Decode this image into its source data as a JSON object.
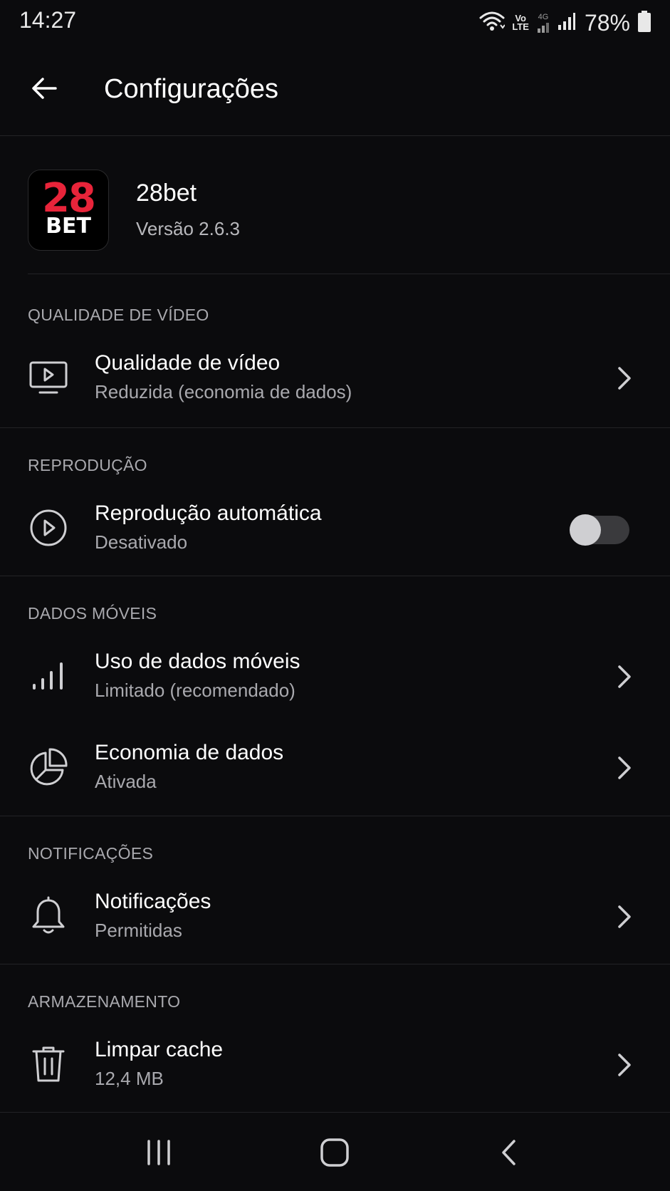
{
  "status_bar": {
    "time": "14:27",
    "volte_top": "Vo",
    "volte_bottom": "LTE",
    "network_type": "4G",
    "battery_percent": "78%"
  },
  "app_bar": {
    "title": "Configurações",
    "back_icon": "arrow-left-icon"
  },
  "app_info": {
    "logo_top": "28",
    "logo_bottom": "BET",
    "name": "28bet",
    "version": "Versão 2.6.3"
  },
  "sections": {
    "video": {
      "header": "QUALIDADE DE VÍDEO",
      "item": {
        "title": "Qualidade de vídeo",
        "subtitle": "Reduzida (economia de dados)",
        "icon": "monitor-play-icon"
      }
    },
    "playback": {
      "header": "REPRODUÇÃO",
      "item": {
        "title": "Reprodução automática",
        "subtitle": "Desativado",
        "icon": "play-circle-icon",
        "toggle_on": false
      }
    },
    "mobile_data": {
      "header": "DADOS MÓVEIS",
      "items": [
        {
          "title": "Uso de dados móveis",
          "subtitle": "Limitado (recomendado)",
          "icon": "signal-bars-icon"
        },
        {
          "title": "Economia de dados",
          "subtitle": "Ativada",
          "icon": "pie-chart-icon"
        }
      ]
    },
    "notifications": {
      "header": "NOTIFICAÇÕES",
      "item": {
        "title": "Notificações",
        "subtitle": "Permitidas",
        "icon": "bell-icon"
      }
    },
    "storage": {
      "header": "ARMAZENAMENTO",
      "item": {
        "title": "Limpar cache",
        "subtitle": "12,4 MB",
        "icon": "trash-icon"
      }
    }
  },
  "colors": {
    "background": "#0b0b0d",
    "text_primary": "#ffffff",
    "text_secondary": "#a9a9ae",
    "divider": "#232326",
    "logo_red": "#e8243a"
  }
}
